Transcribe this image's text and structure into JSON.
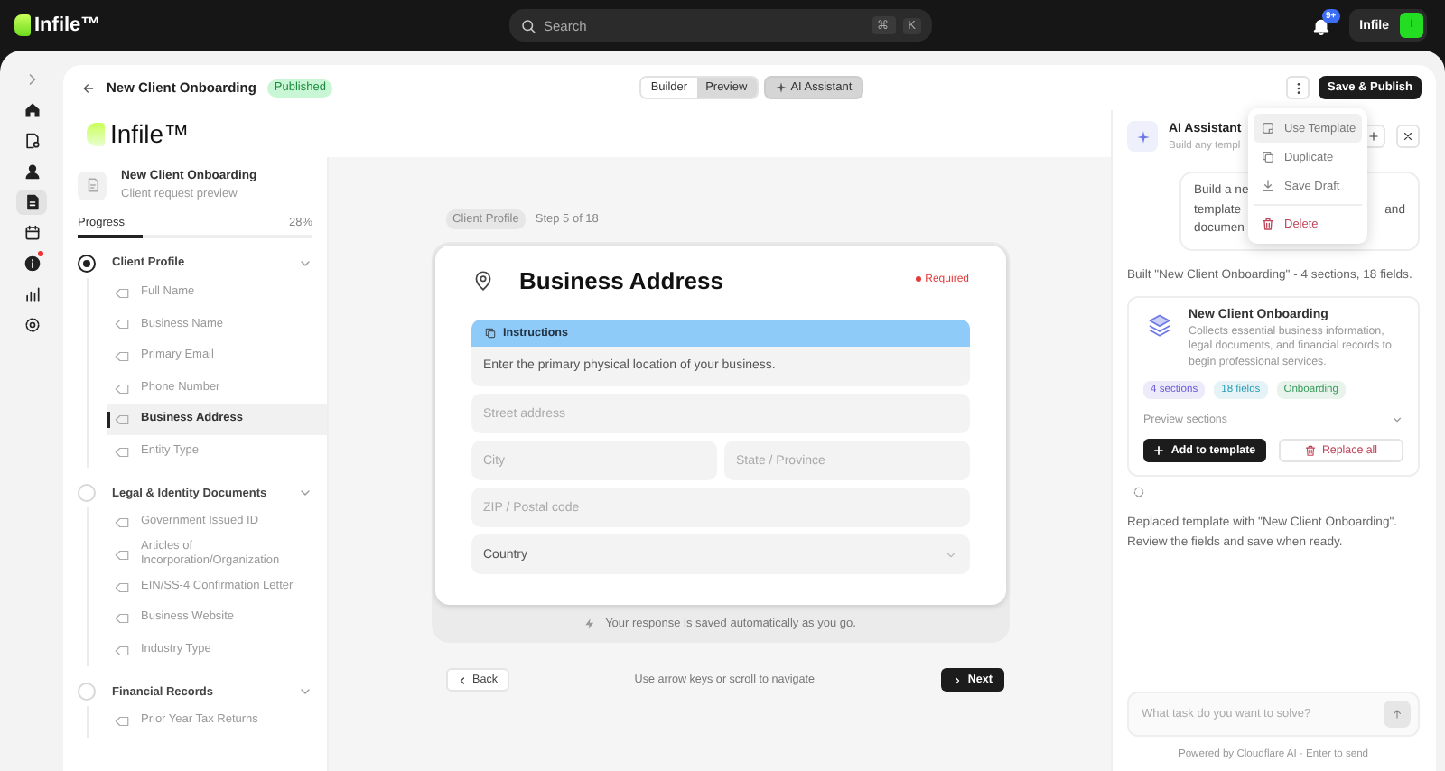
{
  "topbar": {
    "logo": "Infile™",
    "search": {
      "placeholder": "Search",
      "shortcut": [
        "⌘",
        "K"
      ]
    },
    "notifications": {
      "badge": "9+"
    },
    "user": {
      "name": "Infile",
      "initial": "I"
    }
  },
  "rail": {
    "items": [
      {
        "kind": "expand",
        "selected": false
      },
      {
        "kind": "home",
        "selected": false
      },
      {
        "kind": "forms",
        "selected": false
      },
      {
        "kind": "user",
        "selected": false
      },
      {
        "kind": "file",
        "selected": true
      },
      {
        "kind": "calendar",
        "selected": false
      },
      {
        "kind": "info",
        "selected": false,
        "alert": true
      },
      {
        "kind": "chart",
        "selected": false
      },
      {
        "kind": "settings",
        "selected": false
      }
    ]
  },
  "header": {
    "title": "New Client Onboarding",
    "status": "Published",
    "tabs": [
      {
        "label": "Builder",
        "selected": false
      },
      {
        "label": "Preview",
        "selected": true
      }
    ],
    "assistant_toggle": {
      "label": "AI Assistant",
      "on": true
    },
    "primary_button": "Save & Publish"
  },
  "menu": {
    "items": [
      {
        "label": "Use Template",
        "kind": "template",
        "selected": true
      },
      {
        "label": "Duplicate",
        "kind": "duplicate",
        "selected": false
      },
      {
        "label": "Save Draft",
        "kind": "draft",
        "selected": false
      },
      {
        "label": "Delete",
        "kind": "delete",
        "selected": false
      }
    ]
  },
  "brand": {
    "logo": "Infile™"
  },
  "sidebar": {
    "title": "New Client Onboarding",
    "subtitle": "Client request preview",
    "progress": {
      "label": "Progress",
      "reading": "28%",
      "level": 0.28
    },
    "sections": [
      {
        "title": "Client Profile",
        "current": true,
        "expanded": true,
        "children": [
          {
            "label": "Full Name",
            "selected": false
          },
          {
            "label": "Business Name",
            "selected": false
          },
          {
            "label": "Primary Email",
            "selected": false
          },
          {
            "label": "Phone Number",
            "selected": false
          },
          {
            "label": "Business Address",
            "selected": true
          },
          {
            "label": "Entity Type",
            "selected": false
          }
        ]
      },
      {
        "title": "Legal & Identity Documents",
        "current": false,
        "expanded": true,
        "children": [
          {
            "label": "Government Issued ID",
            "selected": false
          },
          {
            "label": "Articles of Incorporation/Organization",
            "selected": false
          },
          {
            "label": "EIN/SS-4 Confirmation Letter",
            "selected": false
          },
          {
            "label": "Business Website",
            "selected": false
          },
          {
            "label": "Industry Type",
            "selected": false
          }
        ]
      },
      {
        "title": "Financial Records",
        "current": false,
        "expanded": true,
        "children": [
          {
            "label": "Prior Year Tax Returns",
            "selected": false
          }
        ]
      }
    ]
  },
  "step": {
    "section": "Client Profile",
    "counter": "Step 5 of 18",
    "title": "Business Address",
    "required": "Required",
    "instructions": {
      "title": "Instructions",
      "text": "Enter the primary physical location of your business."
    },
    "rows": [
      {
        "fields": [
          {
            "kind": "text",
            "placeholder": "Street address"
          }
        ]
      },
      {
        "fields": [
          {
            "kind": "text",
            "placeholder": "City"
          },
          {
            "kind": "text",
            "placeholder": "State / Province"
          }
        ]
      },
      {
        "fields": [
          {
            "kind": "text",
            "placeholder": "ZIP / Postal code"
          }
        ]
      },
      {
        "fields": [
          {
            "kind": "select",
            "value": "Country"
          }
        ]
      }
    ],
    "autosave": "Your response is saved automatically as you go.",
    "nav": {
      "back": "Back",
      "hint": "Use arrow keys or scroll to navigate",
      "next": "Next"
    }
  },
  "assistant": {
    "title": "AI Assistant",
    "subtitle": "Build any templ",
    "user_message": {
      "lines": [
        "Build a ne",
        "template",
        "documen"
      ],
      "tail": "and"
    },
    "messages": [
      {
        "kind": "text",
        "text": "Built \"New Client Onboarding\" - 4 sections, 18 fields."
      },
      {
        "kind": "template",
        "title": "New Client Onboarding",
        "description": "Collects essential business information, legal documents, and financial records to begin professional services.",
        "tags": [
          {
            "label": "4 sections",
            "color": "#6a5ad8"
          },
          {
            "label": "18 fields",
            "color": "#2a9db5"
          },
          {
            "label": "Onboarding",
            "color": "#3a9a5c"
          }
        ],
        "preview": "Preview sections",
        "add": "Add to template",
        "replace": "Replace all"
      },
      {
        "kind": "loading"
      },
      {
        "kind": "text",
        "text": "Replaced template with \"New Client Onboarding\". Review the fields and save when ready."
      }
    ],
    "input": {
      "placeholder": "What task do you want to solve?"
    },
    "footer": "Powered by Cloudflare AI · Enter to send"
  }
}
